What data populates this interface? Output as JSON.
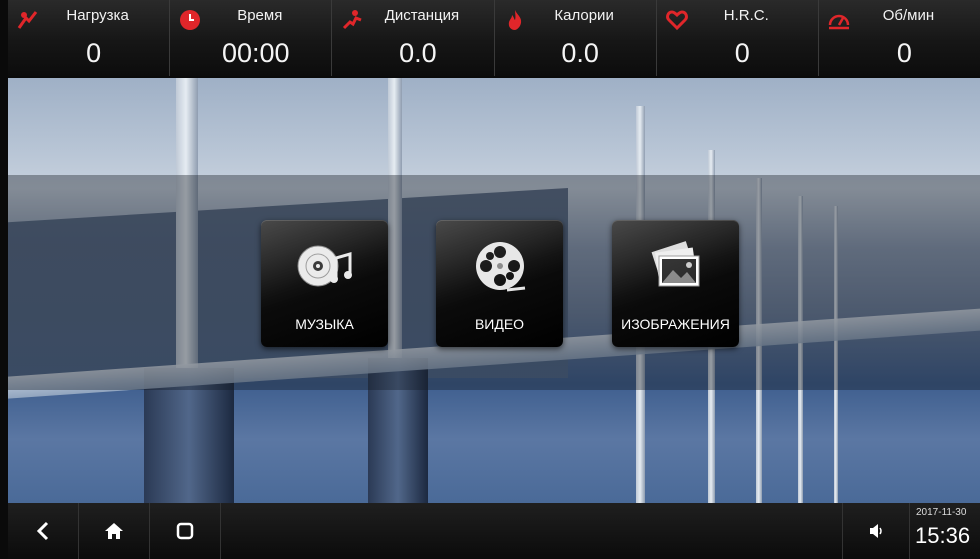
{
  "stats": [
    {
      "label": "Нагрузка",
      "value": "0",
      "icon": "load-icon"
    },
    {
      "label": "Время",
      "value": "00:00",
      "icon": "clock-icon"
    },
    {
      "label": "Дистанция",
      "value": "0.0",
      "icon": "runner-icon"
    },
    {
      "label": "Калории",
      "value": "0.0",
      "icon": "flame-icon"
    },
    {
      "label": "H.R.C.",
      "value": "0",
      "icon": "heart-icon"
    },
    {
      "label": "Об/мин",
      "value": "0",
      "icon": "speedometer-icon"
    }
  ],
  "tiles": {
    "music": {
      "label": "МУЗЫКА",
      "icon": "music-disc-icon"
    },
    "video": {
      "label": "ВИДЕО",
      "icon": "film-reel-icon"
    },
    "images": {
      "label": "ИЗОБРАЖЕНИЯ",
      "icon": "photos-icon"
    }
  },
  "nav": {
    "back_icon": "back-icon",
    "home_icon": "home-icon",
    "recents_icon": "recents-icon",
    "volume_icon": "volume-icon"
  },
  "clock": {
    "date": "2017-11-30",
    "time": "15:36"
  },
  "colors": {
    "accent_red": "#e0262a"
  }
}
